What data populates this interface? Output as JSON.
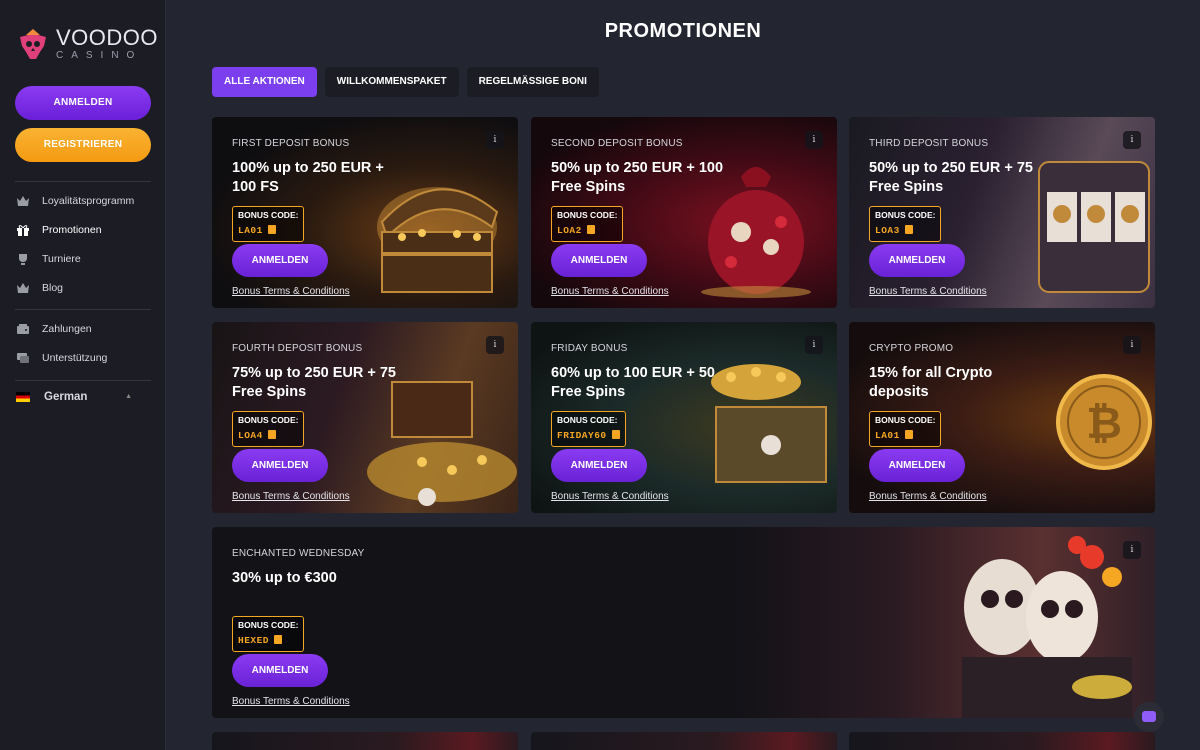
{
  "brand": {
    "name": "VOODOO",
    "sub": "CASINO",
    "accent": "#7b3ff0",
    "orange": "#f5a623"
  },
  "sidebar": {
    "login_label": "ANMELDEN",
    "register_label": "REGISTRIEREN",
    "items": [
      {
        "label": "Loyalitätsprogramm",
        "icon": "crown-icon"
      },
      {
        "label": "Promotionen",
        "icon": "gift-icon"
      },
      {
        "label": "Turniere",
        "icon": "cup-icon"
      },
      {
        "label": "Blog",
        "icon": "crown-icon"
      },
      {
        "label": "Zahlungen",
        "icon": "wallet-icon"
      },
      {
        "label": "Unterstützung",
        "icon": "chat-icon"
      }
    ],
    "language": "German"
  },
  "page": {
    "title": "PROMOTIONEN"
  },
  "tabs": [
    {
      "label": "ALLE AKTIONEN",
      "active": true
    },
    {
      "label": "WILLKOMMENSPAKET",
      "active": false
    },
    {
      "label": "REGELMÄSSIGE BONI",
      "active": false
    }
  ],
  "cards": [
    {
      "label": "FIRST DEPOSIT BONUS",
      "title": "100% up to 250 EUR + 100 FS",
      "code_title": "BONUS CODE:",
      "code": "LA01",
      "button": "ANMELDEN",
      "terms": "Bonus Terms & Conditions"
    },
    {
      "label": "SECOND DEPOSIT BONUS",
      "title": "50% up to 250 EUR + 100 Free Spins",
      "code_title": "BONUS CODE:",
      "code": "LOA2",
      "button": "ANMELDEN",
      "terms": "Bonus Terms & Conditions"
    },
    {
      "label": "THIRD DEPOSIT BONUS",
      "title": "50% up to 250 EUR + 75 Free Spins",
      "code_title": "BONUS CODE:",
      "code": "LOA3",
      "button": "ANMELDEN",
      "terms": "Bonus Terms & Conditions"
    },
    {
      "label": "FOURTH DEPOSIT BONUS",
      "title": "75% up to 250 EUR + 75 Free Spins",
      "code_title": "BONUS CODE:",
      "code": "LOA4",
      "button": "ANMELDEN",
      "terms": "Bonus Terms & Conditions"
    },
    {
      "label": "FRIDAY BONUS",
      "title": "60% up to 100 EUR + 50 Free Spins",
      "code_title": "BONUS CODE:",
      "code": "FRIDAY60",
      "button": "ANMELDEN",
      "terms": "Bonus Terms & Conditions"
    },
    {
      "label": "CRYPTO PROMO",
      "title": "15% for all Crypto deposits",
      "code_title": "BONUS CODE:",
      "code": "LA01",
      "button": "ANMELDEN",
      "terms": "Bonus Terms & Conditions"
    },
    {
      "label": "ENCHANTED WEDNESDAY",
      "title": "30% up to €300",
      "code_title": "BONUS CODE:",
      "code": "HEXED",
      "button": "ANMELDEN",
      "terms": "Bonus Terms & Conditions"
    }
  ],
  "info_glyph": "i"
}
